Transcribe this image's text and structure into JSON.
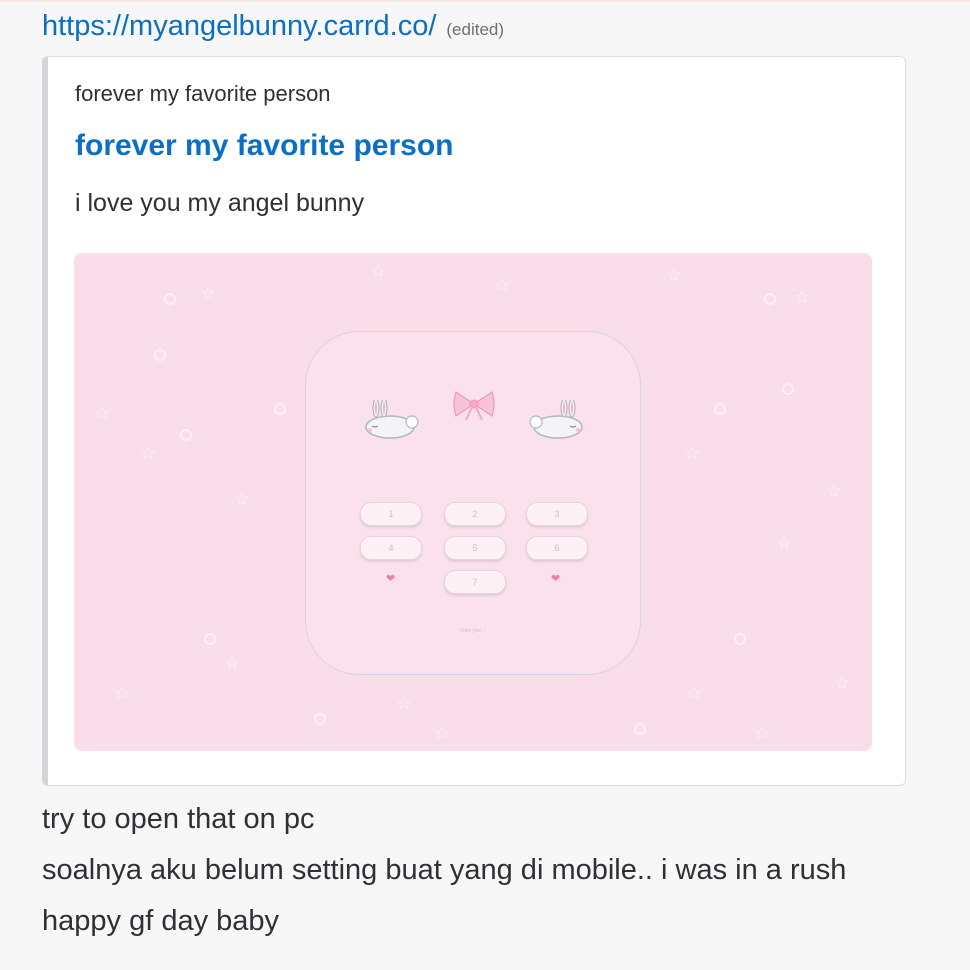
{
  "message": {
    "link": "https://myangelbunny.carrd.co/",
    "edited_label": "(edited)",
    "lines": [
      "try to open that on pc",
      "soalnya aku belum setting buat yang di mobile.. i was in a rush",
      "happy gf day baby"
    ]
  },
  "embed": {
    "provider": "forever my favorite person",
    "title": "forever my favorite person",
    "description": "i love you my angel bunny",
    "preview": {
      "background_color": "#f9dde8",
      "keypad": [
        "1",
        "2",
        "3",
        "4",
        "5",
        "6",
        "7"
      ],
      "footer_text": "i love you ♡"
    }
  },
  "colors": {
    "link": "#0b6fc6",
    "text": "#2e3035",
    "muted": "#6d6f78",
    "accent_pink": "#ee7fa6"
  }
}
